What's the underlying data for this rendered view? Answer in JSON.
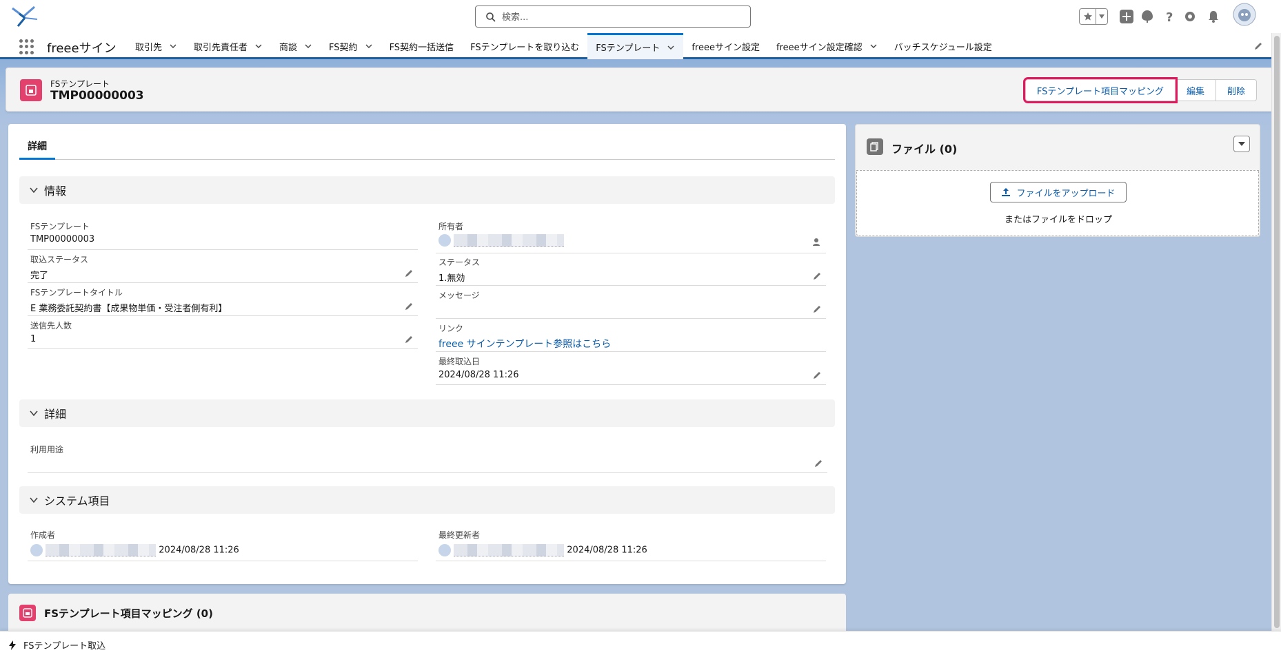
{
  "header": {
    "search_placeholder": "検索..."
  },
  "nav": {
    "app_name": "freeeサイン",
    "items": [
      {
        "label": "取引先",
        "has_menu": true
      },
      {
        "label": "取引先責任者",
        "has_menu": true
      },
      {
        "label": "商談",
        "has_menu": true
      },
      {
        "label": "FS契約",
        "has_menu": true
      },
      {
        "label": "FS契約一括送信",
        "has_menu": false
      },
      {
        "label": "FSテンプレートを取り込む",
        "has_menu": false
      },
      {
        "label": "FSテンプレート",
        "has_menu": true,
        "active": true
      },
      {
        "label": "freeeサイン設定",
        "has_menu": false
      },
      {
        "label": "freeeサイン設定確認",
        "has_menu": true
      },
      {
        "label": "バッチスケジュール設定",
        "has_menu": false
      }
    ]
  },
  "record": {
    "type": "FSテンプレート",
    "name": "TMP00000003",
    "buttons": {
      "mapping": "FSテンプレート項目マッピング",
      "edit": "編集",
      "delete": "削除"
    }
  },
  "tabs": {
    "detail": "詳細"
  },
  "sections": {
    "info": "情報",
    "detail": "詳細",
    "system": "システム項目"
  },
  "fields": {
    "template": {
      "label": "FSテンプレート",
      "value": "TMP00000003"
    },
    "import_status": {
      "label": "取込ステータス",
      "value": "完了"
    },
    "template_title": {
      "label": "FSテンプレートタイトル",
      "value": "E 業務委託契約書【成果物単価・受注者側有利】"
    },
    "recipients": {
      "label": "送信先人数",
      "value": "1"
    },
    "owner": {
      "label": "所有者"
    },
    "status": {
      "label": "ステータス",
      "value": "1.無効"
    },
    "message": {
      "label": "メッセージ",
      "value": ""
    },
    "link": {
      "label": "リンク",
      "value": "freee サインテンプレート参照はこちら"
    },
    "last_import": {
      "label": "最終取込日",
      "value": "2024/08/28 11:26"
    },
    "usage": {
      "label": "利用用途",
      "value": ""
    },
    "created_by": {
      "label": "作成者",
      "date": "2024/08/28 11:26"
    },
    "modified_by": {
      "label": "最終更新者",
      "date": "2024/08/28 11:26"
    }
  },
  "files": {
    "title": "ファイル (0)",
    "upload": "ファイルをアップロード",
    "drop": "またはファイルをドロップ"
  },
  "related": {
    "title": "FSテンプレート項目マッピング (0)"
  },
  "utility": {
    "label": "FSテンプレート取込"
  },
  "colors": {
    "accent": "#0176d3",
    "record_icon": "#e3406d",
    "highlight": "#e0195f"
  }
}
